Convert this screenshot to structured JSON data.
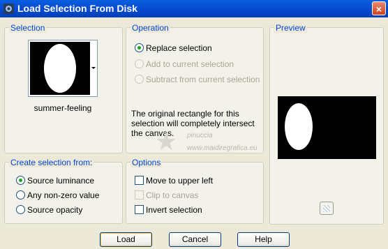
{
  "window": {
    "title": "Load Selection From Disk",
    "close": "×"
  },
  "selection": {
    "label": "Selection",
    "thumbnail_name": "summer-feeling"
  },
  "operation": {
    "label": "Operation",
    "options": [
      {
        "label": "Replace selection",
        "checked": true,
        "enabled": true
      },
      {
        "label": "Add to current selection",
        "checked": false,
        "enabled": false
      },
      {
        "label": "Subtract from current selection",
        "checked": false,
        "enabled": false
      }
    ],
    "info": "The original rectangle for this selection will completely intersect the canvas."
  },
  "preview": {
    "label": "Preview"
  },
  "create_from": {
    "label": "Create selection from:",
    "options": [
      {
        "label": "Source luminance",
        "checked": true
      },
      {
        "label": "Any non-zero value",
        "checked": false
      },
      {
        "label": "Source opacity",
        "checked": false
      }
    ]
  },
  "options_group": {
    "label": "Options",
    "items": [
      {
        "label": "Move to upper left",
        "enabled": true
      },
      {
        "label": "Clip to canvas",
        "enabled": false
      },
      {
        "label": "Invert selection",
        "enabled": true
      }
    ]
  },
  "watermark": {
    "line1": "pinuccia",
    "line2": "www.maidiregrafica.eu"
  },
  "buttons": {
    "load": "Load",
    "cancel": "Cancel",
    "help": "Help"
  },
  "colors": {
    "titlebar": "#0549cf",
    "group_label": "#0046d5",
    "radio_dot": "#21a121"
  }
}
